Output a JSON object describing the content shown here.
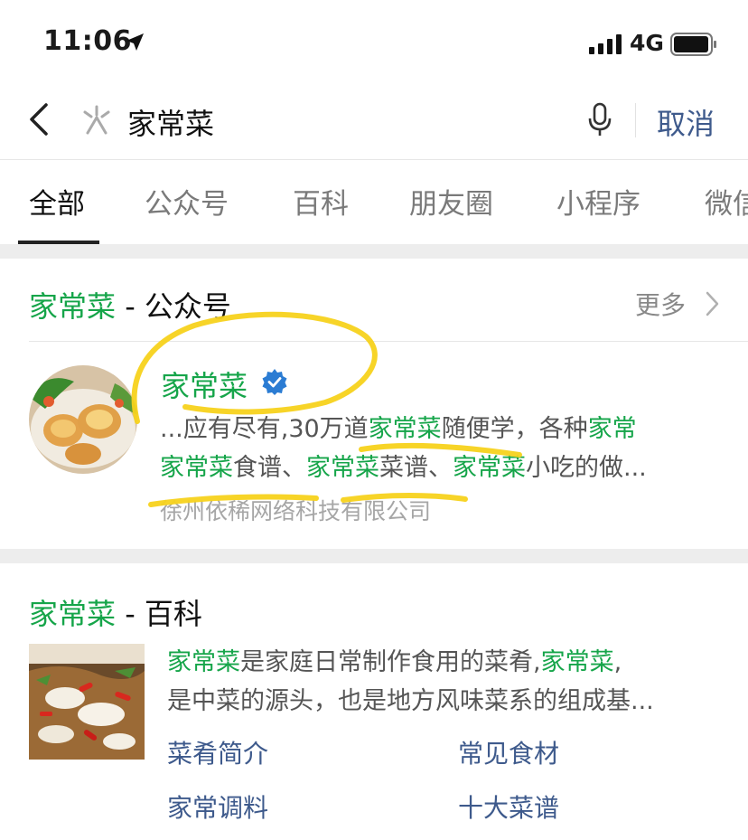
{
  "status_bar": {
    "time": "11:06",
    "network": "4G"
  },
  "search": {
    "query": "家常菜",
    "cancel_label": "取消"
  },
  "tabs": [
    {
      "label": "全部",
      "active": true
    },
    {
      "label": "公众号",
      "active": false
    },
    {
      "label": "百科",
      "active": false
    },
    {
      "label": "朋友圈",
      "active": false
    },
    {
      "label": "小程序",
      "active": false
    },
    {
      "label": "微信",
      "active": false
    }
  ],
  "official_section": {
    "title_keyword": "家常菜",
    "title_suffix": " - 公众号",
    "more_label": "更多",
    "account": {
      "name": "家常菜",
      "desc_line1": [
        {
          "text": "...应有尽有,30万道",
          "hl": false
        },
        {
          "text": "家常菜",
          "hl": true
        },
        {
          "text": "随便学，各种",
          "hl": false
        },
        {
          "text": "家常",
          "hl": true
        }
      ],
      "desc_line2": [
        {
          "text": "家常菜",
          "hl": true
        },
        {
          "text": "食谱、",
          "hl": false
        },
        {
          "text": "家常菜",
          "hl": true
        },
        {
          "text": "菜谱、",
          "hl": false
        },
        {
          "text": "家常菜",
          "hl": true
        },
        {
          "text": "小吃的做...",
          "hl": false
        }
      ],
      "company": "徐州依稀网络科技有限公司"
    }
  },
  "baike_section": {
    "title_keyword": "家常菜",
    "title_suffix": " - 百科",
    "desc_line1": [
      {
        "text": "家常菜",
        "hl": true
      },
      {
        "text": "是家庭日常制作食用的菜肴,",
        "hl": false
      },
      {
        "text": "家常菜",
        "hl": true
      },
      {
        "text": ",",
        "hl": false
      }
    ],
    "desc_line2": "是中菜的源头，也是地方风味菜系的组成基...",
    "links": [
      "菜肴简介",
      "常见食材",
      "家常调料",
      "十大菜谱"
    ]
  },
  "colors": {
    "highlight": "#16a54a",
    "link": "#3e5a8c",
    "verified": "#2b7cd3",
    "scribble": "#f7d21c"
  }
}
